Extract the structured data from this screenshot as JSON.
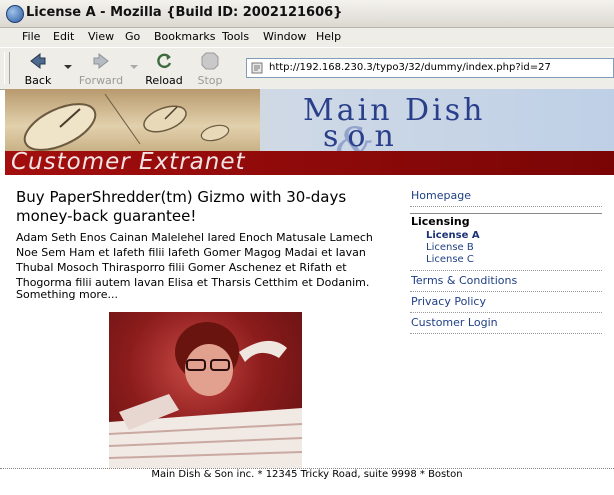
{
  "window": {
    "title": "License A - Mozilla {Build ID: 2002121606}"
  },
  "menu": {
    "items": [
      "File",
      "Edit",
      "View",
      "Go",
      "Bookmarks",
      "Tools",
      "Window",
      "Help"
    ]
  },
  "toolbar": {
    "back_label": "Back",
    "forward_label": "Forward",
    "reload_label": "Reload",
    "stop_label": "Stop",
    "url": "http://192.168.230.3/typo3/32/dummy/index.php?id=27"
  },
  "banner": {
    "brand_line1": "Main Dish",
    "brand_line2": "son",
    "brand_ampersand": "&",
    "tagline": "Customer Extranet"
  },
  "content": {
    "headline": "Buy PaperShredder(tm) Gizmo with 30-days money-back guarantee!",
    "paragraph": "Adam Seth Enos Cainan Malelehel Iared Enoch Matusale Lamech Noe Sem Ham et Iafeth filii Iafeth Gomer Magog Madai et Iavan Thubal Mosoch Thirasporro filii Gomer Aschenez et Rifath et Thogorma filii autem Iavan Elisa et Tharsis Cetthim et Dodanim.",
    "more": "Something more..."
  },
  "nav": {
    "homepage": "Homepage",
    "licensing": "Licensing",
    "license_a": "License A",
    "license_b": "License B",
    "license_c": "License C",
    "terms": "Terms & Conditions",
    "privacy": "Privacy Policy",
    "login": "Customer Login"
  },
  "footer": {
    "address": "Main Dish & Son inc. * 12345 Tricky Road, suite 9998 * Boston"
  },
  "colors": {
    "link": "#1f3f85",
    "banner_red": "#8a0909",
    "brand_blue": "#2a3f8a"
  }
}
